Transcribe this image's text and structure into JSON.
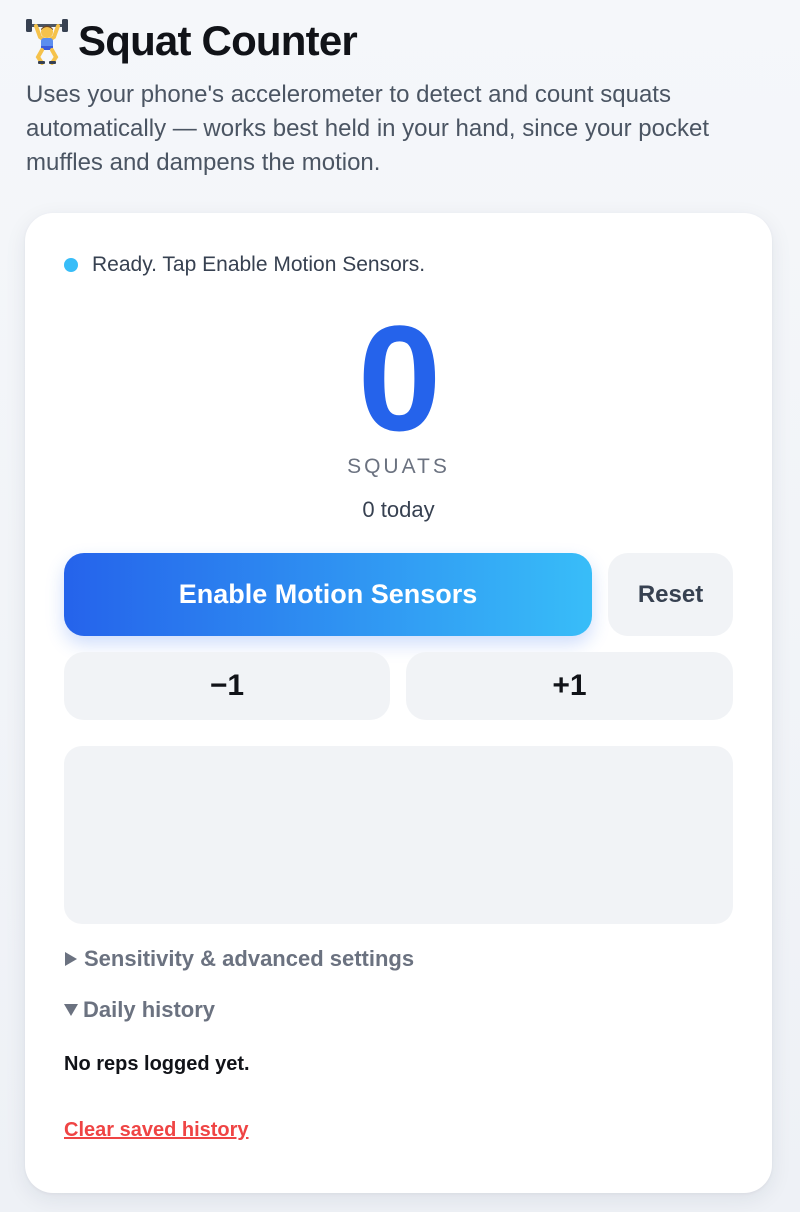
{
  "header": {
    "title": "Squat Counter",
    "icon": "weightlifter-icon",
    "description": "Uses your phone's accelerometer to detect and count squats automatically — works best held in your hand, since your pocket muffles and dampens the motion."
  },
  "status": {
    "text": "Ready. Tap Enable Motion Sensors.",
    "dot_color": "#38bdf8"
  },
  "counter": {
    "value": "0",
    "unit": "SQUATS",
    "today": "0 today",
    "color": "#2563eb"
  },
  "controls": {
    "enable_label": "Enable Motion Sensors",
    "reset_label": "Reset",
    "decrement_label": "−1",
    "increment_label": "+1"
  },
  "sections": {
    "settings_label": "Sensitivity & advanced settings",
    "settings_open": false,
    "history_label": "Daily history",
    "history_open": true
  },
  "history": {
    "empty_text": "No reps logged yet.",
    "clear_label": "Clear saved history"
  },
  "colors": {
    "accent": "#2563eb",
    "accent_light": "#38bdf8",
    "danger": "#ef4444"
  }
}
